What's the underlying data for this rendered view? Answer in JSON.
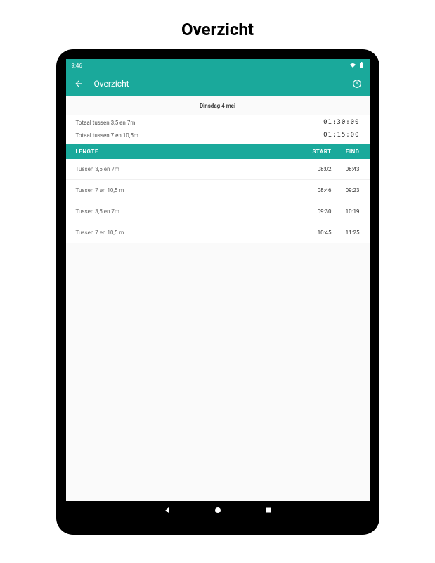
{
  "page_heading": "Overzicht",
  "status": {
    "time": "9:46"
  },
  "appbar": {
    "title": "Overzicht"
  },
  "date_header": "Dinsdag 4 mei",
  "totals": [
    {
      "label": "Totaal tussen 3,5 en 7m",
      "value": "01:30:00"
    },
    {
      "label": "Totaal tussen 7 en 10,5m",
      "value": "01:15:00"
    }
  ],
  "columns": {
    "lengte": "LENGTE",
    "start": "START",
    "eind": "EIND"
  },
  "rows": [
    {
      "lengte": "Tussen 3,5 en 7m",
      "start": "08:02",
      "eind": "08:43"
    },
    {
      "lengte": "Tussen 7 en 10,5 m",
      "start": "08:46",
      "eind": "09:23"
    },
    {
      "lengte": "Tussen 3,5 en 7m",
      "start": "09:30",
      "eind": "10:19"
    },
    {
      "lengte": "Tussen 7 en 10,5 m",
      "start": "10:45",
      "eind": "11:25"
    }
  ]
}
